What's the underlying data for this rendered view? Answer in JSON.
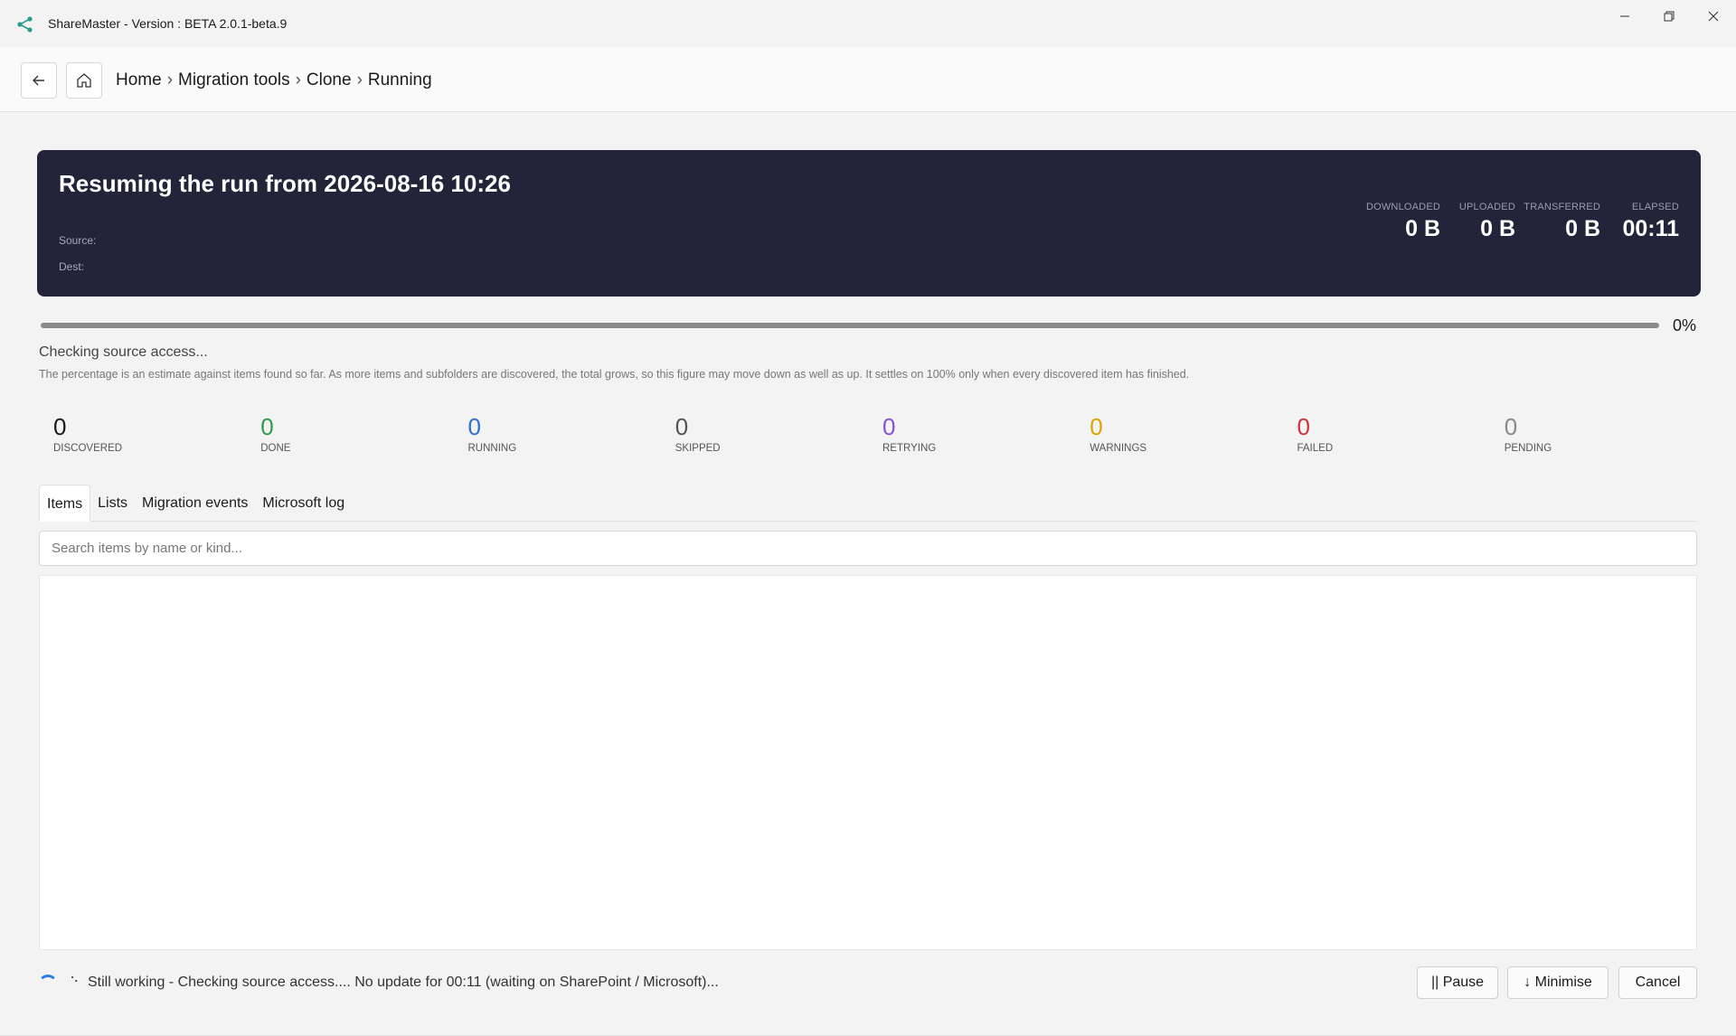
{
  "window": {
    "title": "ShareMaster - Version : BETA 2.0.1-beta.9",
    "controls": {
      "minimize": "minimize",
      "maximize": "restore",
      "close": "close"
    }
  },
  "breadcrumb": [
    "Home",
    "Migration tools",
    "Clone",
    "Running"
  ],
  "breadcrumb_separator": "›",
  "hero": {
    "title": "Resuming the run from 2026-08-16 10:26",
    "source_label": "Source:",
    "dest_label": "Dest:",
    "stats": [
      {
        "label": "DOWNLOADED",
        "value": "0 B"
      },
      {
        "label": "UPLOADED",
        "value": "0 B"
      },
      {
        "label": "TRANSFERRED",
        "value": "0 B"
      },
      {
        "label": "ELAPSED",
        "value": "00:11"
      }
    ]
  },
  "progress": {
    "percent_text": "0%",
    "fraction": 0,
    "status": "Checking source access...",
    "note": "The percentage is an estimate against items found so far. As more items and subfolders are discovered, the total grows, so this figure may move down as well as up. It settles on 100% only when every discovered item has finished."
  },
  "counters": [
    {
      "value": "0",
      "label": "DISCOVERED",
      "color": "#1b1b1b"
    },
    {
      "value": "0",
      "label": "DONE",
      "color": "#2e9a4a"
    },
    {
      "value": "0",
      "label": "RUNNING",
      "color": "#2f6fd6"
    },
    {
      "value": "0",
      "label": "SKIPPED",
      "color": "#555555"
    },
    {
      "value": "0",
      "label": "RETRYING",
      "color": "#8a4fe0"
    },
    {
      "value": "0",
      "label": "WARNINGS",
      "color": "#e0a400"
    },
    {
      "value": "0",
      "label": "FAILED",
      "color": "#d13438"
    },
    {
      "value": "0",
      "label": "PENDING",
      "color": "#8a8a8a"
    }
  ],
  "tabs": [
    "Items",
    "Lists",
    "Migration events",
    "Microsoft log"
  ],
  "active_tab": "Items",
  "search": {
    "placeholder": "Search items by name or kind..."
  },
  "footer": {
    "dots": "⠑",
    "message": "Still working - Checking source access.... No update for 00:11 (waiting on SharePoint / Microsoft)...",
    "pause_label": "|| Pause",
    "minimise_label": "↓ Minimise",
    "cancel_label": "Cancel"
  },
  "colors": {
    "hero_bg": "#23233a",
    "accent": "#2a7de1"
  }
}
